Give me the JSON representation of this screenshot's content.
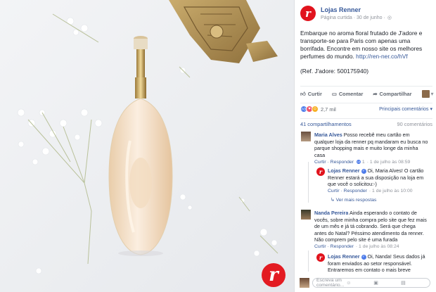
{
  "post": {
    "page_name": "Lojas Renner",
    "logo_letter": "r",
    "date": "Página curtida · 30 de junho ·",
    "privacy_icon": "globe-icon",
    "text": "Embarque no aroma floral frutado de J'adore e transporte-se para Paris com apenas uma borrifada. Encontre em nosso site os melhores perfumes do mundo.",
    "link": "http://ren-ner.co/hVf",
    "ref": "(Ref. J'adore: 500175940)",
    "actions": {
      "like": "Curtir",
      "comment": "Comentar",
      "share": "Compartilhar"
    },
    "reactions_count": "2,7 mil",
    "top_comments": "Principais comentários ▾",
    "shares": "41 compartilhamentos",
    "comments_count": "90 comentários"
  },
  "comments": [
    {
      "name": "Maria Alves",
      "text": "Posso recebê meu cartão em qualquer loja da renner pq mandaram eu busca no parque shopping mais e muito longe da minha casa",
      "reply": "Curtir · Responder",
      "likes": "1",
      "time": "· 1 de julho às 08:59"
    },
    {
      "name": "Lojas Renner",
      "text": "Oi, Maria Alves! O cartão Renner estará a sua disposição na loja em que você o solicitou:-)",
      "reply": "Curtir · Responder",
      "time": "· 1 de julho às 10:00"
    },
    {
      "name": "Nanda Pereira",
      "text": "Ainda esperando o contato de vocês, sobre minha compra pelo site que fez mais de um mês e já tá cobrando. Será que chega antes do Natal? Péssimo atendimento da renner. Não comprem pelo site é uma furada",
      "reply": "Curtir · Responder",
      "time": "· 1 de julho às 08:24"
    },
    {
      "name": "Lojas Renner",
      "text": "Oi, Nanda! Seus dados já foram enviados ao setor responsável. Entraremos em contato o mais breve possível com um retorno. :)",
      "reply": "",
      "time": ""
    }
  ],
  "more_responses": "↳ Ver mais respostas",
  "write_placeholder": "Escreva um comentário...",
  "colors": {
    "brand_red": "#e1131d",
    "link_blue": "#365899",
    "like_blue": "#4e7cea"
  }
}
